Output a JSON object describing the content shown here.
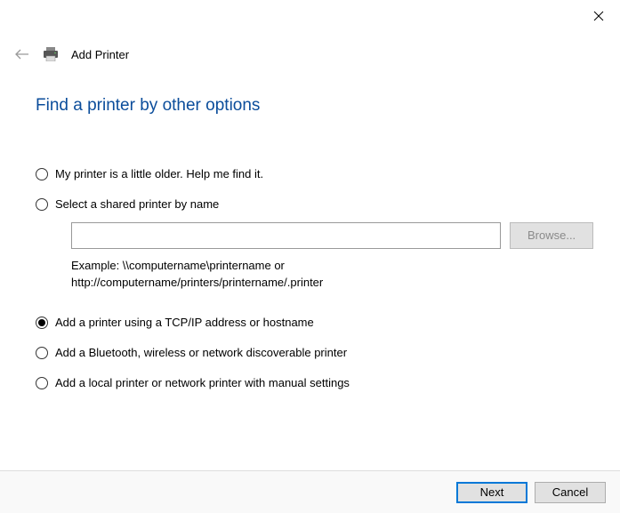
{
  "header": {
    "title": "Add Printer"
  },
  "heading": "Find a printer by other options",
  "options": {
    "older": "My printer is a little older. Help me find it.",
    "shared": "Select a shared printer by name",
    "shared_value": "",
    "browse_label": "Browse...",
    "example_line1": "Example: \\\\computername\\printername or",
    "example_line2": "http://computername/printers/printername/.printer",
    "tcpip": "Add a printer using a TCP/IP address or hostname",
    "bluetooth": "Add a Bluetooth, wireless or network discoverable printer",
    "local": "Add a local printer or network printer with manual settings"
  },
  "selected": "tcpip",
  "footer": {
    "next": "Next",
    "cancel": "Cancel"
  }
}
